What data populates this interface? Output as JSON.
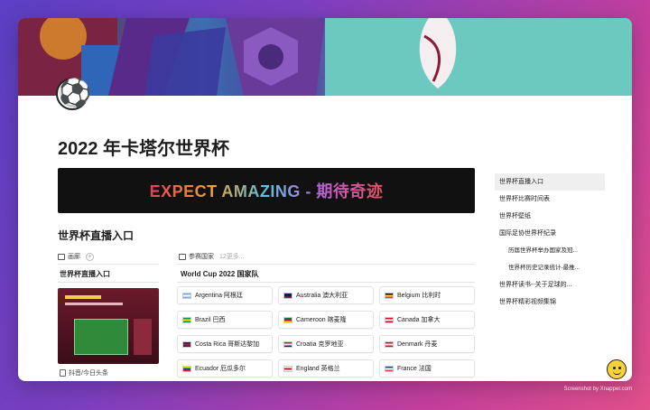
{
  "page": {
    "title": "2022 年卡塔尔世界杯",
    "banner_text": "EXPECT AMAZING - 期待奇迹"
  },
  "section": {
    "heading": "世界杯直播入口"
  },
  "left_view": {
    "tab_label": "画廊",
    "add_label": "+",
    "subheading": "世界杯直播入口",
    "card_caption": "抖音/今日头条"
  },
  "right_view": {
    "tab_label": "参赛国家",
    "more_label": "12更多...",
    "subheading": "World Cup 2022 国家队",
    "teams": [
      {
        "name": "Argentina 阿根廷",
        "flag": [
          "#74acdf",
          "#ffffff",
          "#74acdf"
        ]
      },
      {
        "name": "Australia 澳大利亚",
        "flag": [
          "#012169",
          "#012169",
          "#c8102e"
        ]
      },
      {
        "name": "Belgium 比利时",
        "flag": [
          "#000000",
          "#fdda24",
          "#ef3340"
        ]
      },
      {
        "name": "Brazil 巴西",
        "flag": [
          "#009c3b",
          "#ffdf00",
          "#009c3b"
        ]
      },
      {
        "name": "Cameroon 喀麦隆",
        "flag": [
          "#007a5e",
          "#ce1126",
          "#fcd116"
        ]
      },
      {
        "name": "Canada 加拿大",
        "flag": [
          "#d80621",
          "#ffffff",
          "#d80621"
        ]
      },
      {
        "name": "Costa Rica 哥斯达黎加",
        "flag": [
          "#002b7f",
          "#ce1126",
          "#002b7f"
        ]
      },
      {
        "name": "Croatia 克罗地亚",
        "flag": [
          "#ff0000",
          "#ffffff",
          "#171796"
        ]
      },
      {
        "name": "Denmark 丹麦",
        "flag": [
          "#c8102e",
          "#ffffff",
          "#c8102e"
        ]
      },
      {
        "name": "Ecuador 厄瓜多尔",
        "flag": [
          "#ffdd00",
          "#034ea2",
          "#ed1c24"
        ]
      },
      {
        "name": "England 英格兰",
        "flag": [
          "#ffffff",
          "#ce1124",
          "#ffffff"
        ]
      },
      {
        "name": "France 法国",
        "flag": [
          "#0055a4",
          "#ffffff",
          "#ef4135"
        ]
      }
    ]
  },
  "toc": {
    "items": [
      {
        "label": "世界杯直播入口",
        "level": 1,
        "active": true
      },
      {
        "label": "世界杯比赛时间表",
        "level": 1,
        "active": false
      },
      {
        "label": "世界杯壁纸",
        "level": 1,
        "active": false
      },
      {
        "label": "国际足协世界杯纪录",
        "level": 1,
        "active": false
      },
      {
        "label": "历届世界杯举办国家及冠...",
        "level": 2,
        "active": false
      },
      {
        "label": "世界杯历史记录统计-最推...",
        "level": 2,
        "active": false
      },
      {
        "label": "世界杯读书--关于足球的...",
        "level": 1,
        "active": false
      },
      {
        "label": "世界杯精彩视频集锦",
        "level": 1,
        "active": false
      }
    ]
  },
  "icons": {
    "page_icon": "soccer-ball-icon",
    "mascot": "smiley-mascot-icon"
  },
  "footer": {
    "credit": "Screenshot by Xnapper.com"
  }
}
